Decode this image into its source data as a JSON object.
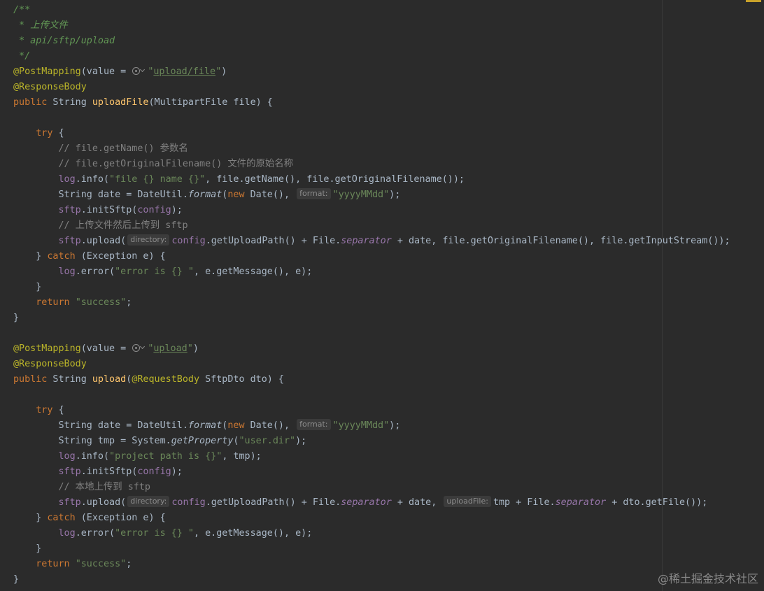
{
  "editor": {
    "theme_colors": {
      "background": "#2b2b2b",
      "default_text": "#a9b7c6",
      "keyword": "#cc7832",
      "annotation": "#bbb529",
      "method_declaration": "#ffc66d",
      "string": "#6a8759",
      "field": "#9876aa",
      "doc_comment": "#629755",
      "line_comment": "#808080"
    },
    "icons": [
      "url-globe-icon",
      "chevron-down-icon"
    ],
    "lines": [
      [
        [
          "t-comment",
          "/**"
        ]
      ],
      [
        [
          "t-comment",
          " * 上传文件"
        ]
      ],
      [
        [
          "t-comment",
          " * api/sftp/upload"
        ]
      ],
      [
        [
          "t-comment",
          " */"
        ]
      ],
      [
        [
          "t-ann",
          "@PostMapping"
        ],
        [
          "",
          "(value = "
        ],
        [
          "icon",
          "url-globe-icon"
        ],
        [
          "t-str",
          "\""
        ],
        [
          "t-url",
          "upload/file"
        ],
        [
          "t-str",
          "\""
        ],
        [
          "",
          ")"
        ]
      ],
      [
        [
          "t-ann",
          "@ResponseBody"
        ]
      ],
      [
        [
          "t-kw",
          "public"
        ],
        [
          "",
          " String "
        ],
        [
          "t-fn",
          "uploadFile"
        ],
        [
          "",
          "(MultipartFile file) {"
        ]
      ],
      [],
      [
        [
          "",
          "    "
        ],
        [
          "t-kw",
          "try"
        ],
        [
          "",
          " {"
        ]
      ],
      [
        [
          "",
          "        "
        ],
        [
          "t-line-comment",
          "// file.getName() 参数名"
        ]
      ],
      [
        [
          "",
          "        "
        ],
        [
          "t-line-comment",
          "// file.getOriginalFilename() 文件的原始名称"
        ]
      ],
      [
        [
          "",
          "        "
        ],
        [
          "t-field",
          "log"
        ],
        [
          "",
          ".info("
        ],
        [
          "t-str",
          "\"file {} name {}\""
        ],
        [
          "",
          ", file.getName(), file.getOriginalFilename());"
        ]
      ],
      [
        [
          "",
          "        String date = DateUtil."
        ],
        [
          "t-italic",
          "format"
        ],
        [
          "",
          "("
        ],
        [
          "t-kw",
          "new"
        ],
        [
          "",
          " Date(), "
        ],
        [
          "hint",
          "format:"
        ],
        [
          "t-str",
          "\"yyyyMMdd\""
        ],
        [
          "",
          ");"
        ]
      ],
      [
        [
          "",
          "        "
        ],
        [
          "t-field",
          "sftp"
        ],
        [
          "",
          ".initSftp("
        ],
        [
          "t-field",
          "config"
        ],
        [
          "",
          ");"
        ]
      ],
      [
        [
          "",
          "        "
        ],
        [
          "t-line-comment",
          "// 上传文件然后上传到 sftp"
        ]
      ],
      [
        [
          "",
          "        "
        ],
        [
          "t-field",
          "sftp"
        ],
        [
          "",
          ".upload("
        ],
        [
          "hint",
          "directory:"
        ],
        [
          "t-field",
          "config"
        ],
        [
          "",
          ".getUploadPath() + File."
        ],
        [
          "t-static",
          "separator"
        ],
        [
          "",
          " + date, file.getOriginalFilename(), file.getInputStream());"
        ]
      ],
      [
        [
          "",
          "    } "
        ],
        [
          "t-kw",
          "catch"
        ],
        [
          "",
          " (Exception e) {"
        ]
      ],
      [
        [
          "",
          "        "
        ],
        [
          "t-field",
          "log"
        ],
        [
          "",
          ".error("
        ],
        [
          "t-str",
          "\"error is {} \""
        ],
        [
          "",
          ", e.getMessage(), e);"
        ]
      ],
      [
        [
          "",
          "    }"
        ]
      ],
      [
        [
          "",
          "    "
        ],
        [
          "t-kw",
          "return"
        ],
        [
          "",
          " "
        ],
        [
          "t-str",
          "\"success\""
        ],
        [
          "",
          ";"
        ]
      ],
      [
        [
          "",
          "}"
        ]
      ],
      [],
      [
        [
          "t-ann",
          "@PostMapping"
        ],
        [
          "",
          "(value = "
        ],
        [
          "icon",
          "url-globe-icon"
        ],
        [
          "t-str",
          "\""
        ],
        [
          "t-url",
          "upload"
        ],
        [
          "t-str",
          "\""
        ],
        [
          "",
          ")"
        ]
      ],
      [
        [
          "t-ann",
          "@ResponseBody"
        ]
      ],
      [
        [
          "t-kw",
          "public"
        ],
        [
          "",
          " String "
        ],
        [
          "t-fn",
          "upload"
        ],
        [
          "",
          "("
        ],
        [
          "t-ann",
          "@RequestBody"
        ],
        [
          "",
          " SftpDto dto) {"
        ]
      ],
      [],
      [
        [
          "",
          "    "
        ],
        [
          "t-kw",
          "try"
        ],
        [
          "",
          " {"
        ]
      ],
      [
        [
          "",
          "        String date = DateUtil."
        ],
        [
          "t-italic",
          "format"
        ],
        [
          "",
          "("
        ],
        [
          "t-kw",
          "new"
        ],
        [
          "",
          " Date(), "
        ],
        [
          "hint",
          "format:"
        ],
        [
          "t-str",
          "\"yyyyMMdd\""
        ],
        [
          "",
          ");"
        ]
      ],
      [
        [
          "",
          "        String tmp = System."
        ],
        [
          "t-italic",
          "getProperty"
        ],
        [
          "",
          "("
        ],
        [
          "t-str",
          "\"user.dir\""
        ],
        [
          "",
          ");"
        ]
      ],
      [
        [
          "",
          "        "
        ],
        [
          "t-field",
          "log"
        ],
        [
          "",
          ".info("
        ],
        [
          "t-str",
          "\"project path is {}\""
        ],
        [
          "",
          ", tmp);"
        ]
      ],
      [
        [
          "",
          "        "
        ],
        [
          "t-field",
          "sftp"
        ],
        [
          "",
          ".initSftp("
        ],
        [
          "t-field",
          "config"
        ],
        [
          "",
          ");"
        ]
      ],
      [
        [
          "",
          "        "
        ],
        [
          "t-line-comment",
          "// 本地上传到 sftp"
        ]
      ],
      [
        [
          "",
          "        "
        ],
        [
          "t-field",
          "sftp"
        ],
        [
          "",
          ".upload("
        ],
        [
          "hint",
          "directory:"
        ],
        [
          "t-field",
          "config"
        ],
        [
          "",
          ".getUploadPath() + File."
        ],
        [
          "t-static",
          "separator"
        ],
        [
          "",
          " + date, "
        ],
        [
          "hint",
          "uploadFile:"
        ],
        [
          "",
          "tmp + File."
        ],
        [
          "t-static",
          "separator"
        ],
        [
          "",
          " + dto.getFile());"
        ]
      ],
      [
        [
          "",
          "    } "
        ],
        [
          "t-kw",
          "catch"
        ],
        [
          "",
          " (Exception e) {"
        ]
      ],
      [
        [
          "",
          "        "
        ],
        [
          "t-field",
          "log"
        ],
        [
          "",
          ".error("
        ],
        [
          "t-str",
          "\"error is {} \""
        ],
        [
          "",
          ", e.getMessage(), e);"
        ]
      ],
      [
        [
          "",
          "    }"
        ]
      ],
      [
        [
          "",
          "    "
        ],
        [
          "t-kw",
          "return"
        ],
        [
          "",
          " "
        ],
        [
          "t-str",
          "\"success\""
        ],
        [
          "",
          ";"
        ]
      ],
      [
        [
          "",
          "}"
        ]
      ]
    ]
  },
  "watermark": "@稀土掘金技术社区"
}
